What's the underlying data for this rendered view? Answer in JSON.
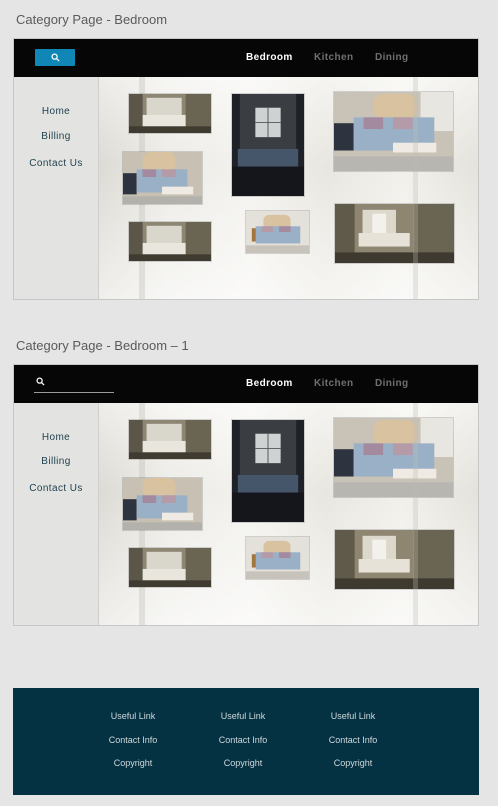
{
  "artboards": [
    {
      "title": "Category Page - Bedroom",
      "search_icon": "search-icon",
      "nav": [
        "Bedroom",
        "Kitchen",
        "Dining"
      ],
      "sidebar": [
        "Home",
        "Billing",
        "Contact Us"
      ]
    },
    {
      "title": "Category Page - Bedroom – 1",
      "search_icon": "search-icon",
      "nav": [
        "Bedroom",
        "Kitchen",
        "Dining"
      ],
      "sidebar": [
        "Home",
        "Billing",
        "Contact Us"
      ]
    }
  ],
  "footer": {
    "columns": [
      [
        "Useful Link",
        "Contact Info",
        "Copyright"
      ],
      [
        "Useful Link",
        "Contact Info",
        "Copyright"
      ],
      [
        "Useful Link",
        "Contact Info",
        "Copyright"
      ]
    ]
  },
  "colors": {
    "topbar": "#060606",
    "search_button": "#0f86b5",
    "footer": "#053242",
    "sidebar_text": "#1d3f4d"
  }
}
